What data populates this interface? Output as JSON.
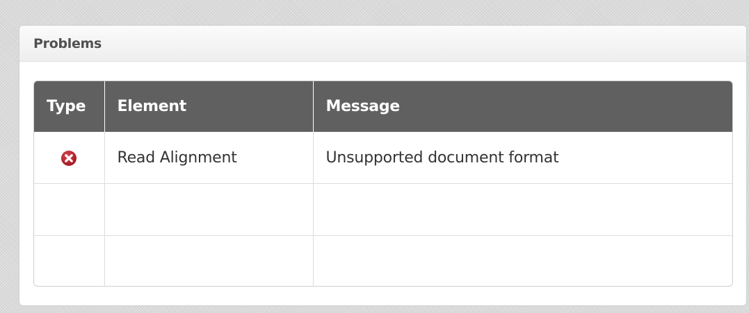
{
  "panel": {
    "title": "Problems"
  },
  "table": {
    "columns": [
      {
        "label": "Type"
      },
      {
        "label": "Element"
      },
      {
        "label": "Message"
      }
    ],
    "rows": [
      {
        "type_icon": "error-icon",
        "element": "Read Alignment",
        "message": "Unsupported document format"
      },
      {
        "type_icon": "",
        "element": "",
        "message": ""
      },
      {
        "type_icon": "",
        "element": "",
        "message": ""
      }
    ]
  },
  "colors": {
    "header_bg": "#606060",
    "error_red": "#b0202a"
  }
}
